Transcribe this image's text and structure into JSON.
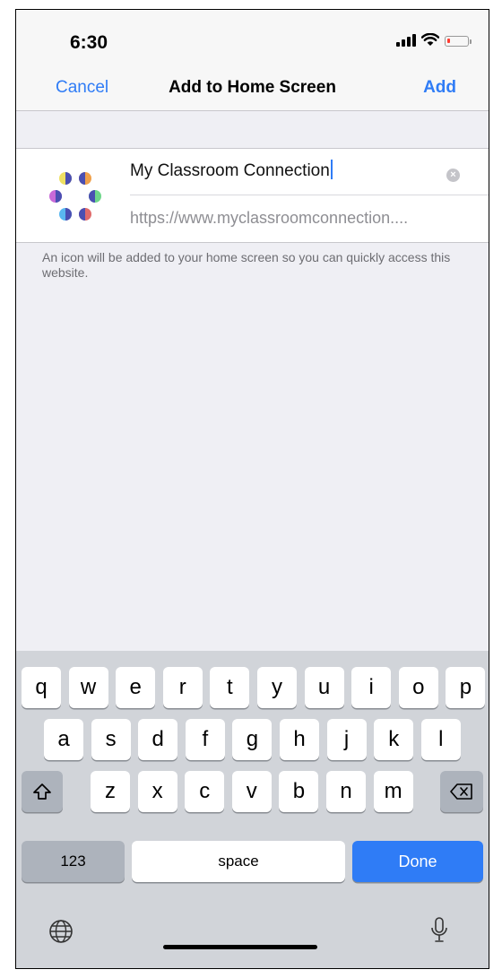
{
  "status": {
    "time": "6:30"
  },
  "nav": {
    "cancel": "Cancel",
    "title": "Add to Home Screen",
    "add": "Add"
  },
  "form": {
    "name_value": "My Classroom Connection",
    "url": "https://www.myclassroomconnection....",
    "clear_glyph": "×"
  },
  "hint": "An icon will be added to your home screen so you can quickly access this website.",
  "keyboard": {
    "row1": [
      "q",
      "w",
      "e",
      "r",
      "t",
      "y",
      "u",
      "i",
      "o",
      "p"
    ],
    "row2": [
      "a",
      "s",
      "d",
      "f",
      "g",
      "h",
      "j",
      "k",
      "l"
    ],
    "row3": [
      "z",
      "x",
      "c",
      "v",
      "b",
      "n",
      "m"
    ],
    "numbers": "123",
    "space": "space",
    "done": "Done"
  },
  "colors": {
    "accent": "#2f7cf6",
    "keyboard_bg": "#d1d4d9",
    "battery_low": "#ff3b30"
  }
}
